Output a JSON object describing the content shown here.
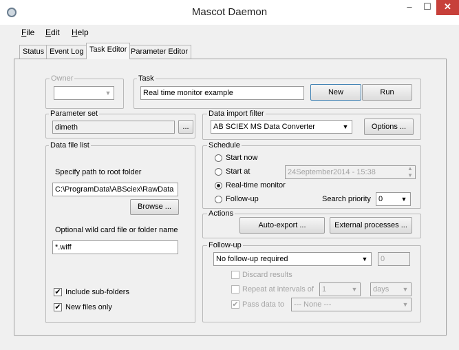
{
  "window": {
    "title": "Mascot Daemon",
    "minimize": "–",
    "maximize": "☐",
    "close": "✕"
  },
  "menu": [
    {
      "label": "File"
    },
    {
      "label": "Edit"
    },
    {
      "label": "Help"
    }
  ],
  "tabs": [
    {
      "label": "Status"
    },
    {
      "label": "Event Log"
    },
    {
      "label": "Task Editor"
    },
    {
      "label": "Parameter Editor"
    }
  ],
  "active_tab": "Task Editor",
  "owner": {
    "label": "Owner",
    "value": ""
  },
  "task": {
    "label": "Task",
    "value": "Real time monitor example",
    "new_button": "New",
    "run_button": "Run"
  },
  "parameter_set": {
    "label": "Parameter set",
    "value": "dimeth",
    "browse": "..."
  },
  "import_filter": {
    "label": "Data import filter",
    "value": "AB SCIEX MS Data Converter",
    "options_button": "Options ..."
  },
  "data_file_list": {
    "label": "Data file list",
    "path_label": "Specify path to root folder",
    "path_value": "C:\\ProgramData\\ABSciex\\RawData",
    "browse_button": "Browse ...",
    "wildcard_label": "Optional wild card file or folder name",
    "wildcard_value": "*.wiff",
    "include_subfolders": "Include sub-folders",
    "new_files_only": "New files only"
  },
  "schedule": {
    "label": "Schedule",
    "options": [
      "Start now",
      "Start at",
      "Real-time monitor",
      "Follow-up"
    ],
    "selected": "Real-time monitor",
    "start_at_value": "24September2014 - 15:38",
    "search_priority_label": "Search priority",
    "search_priority_value": "0"
  },
  "actions": {
    "label": "Actions",
    "auto_export": "Auto-export ...",
    "external_processes": "External processes ..."
  },
  "followup": {
    "label": "Follow-up",
    "mode": "No follow-up required",
    "count": "0",
    "discard_results": "Discard results",
    "repeat_label": "Repeat at intervals of",
    "repeat_value": "1",
    "repeat_unit": "days",
    "pass_data_label": "Pass data to",
    "pass_data_value": "--- None ---"
  }
}
